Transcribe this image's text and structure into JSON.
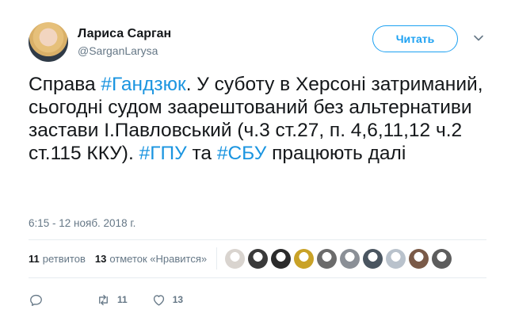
{
  "author": {
    "name": "Лариса Сарган",
    "handle": "@SarganLarysa"
  },
  "follow_label": "Читать",
  "tweet": {
    "t1": "Справа ",
    "tag1": "#Гандзюк",
    "t2": ". У суботу в Херсоні затриманий, сьогодні судом заарештований без альтернативи застави І.Павловський (ч.3 ст.27, п. 4,6,11,12 ч.2 ст.115  ККУ). ",
    "tag2": "#ГПУ",
    "t3": " та ",
    "tag3": "#СБУ",
    "t4": " працюють далі"
  },
  "timestamp": "6:15 - 12 нояб. 2018 г.",
  "stats": {
    "retweets_count": "11",
    "retweets_label": "ретвитов",
    "likes_count": "13",
    "likes_label": "отметок «Нравится»"
  },
  "liker_avatar_colors": [
    "#d9d4cf",
    "#3a3a3a",
    "#2b2b2b",
    "#c9a227",
    "#6b6b6b",
    "#8a8f96",
    "#4a5560",
    "#b9c2cc",
    "#7a5a48",
    "#5d5d5d"
  ],
  "actions": {
    "reply_icon": "reply-icon",
    "retweet_count": "11",
    "like_count": "13"
  },
  "colors": {
    "accent": "#1da1f2",
    "hashtag": "#1b95e0",
    "muted": "#657786"
  }
}
